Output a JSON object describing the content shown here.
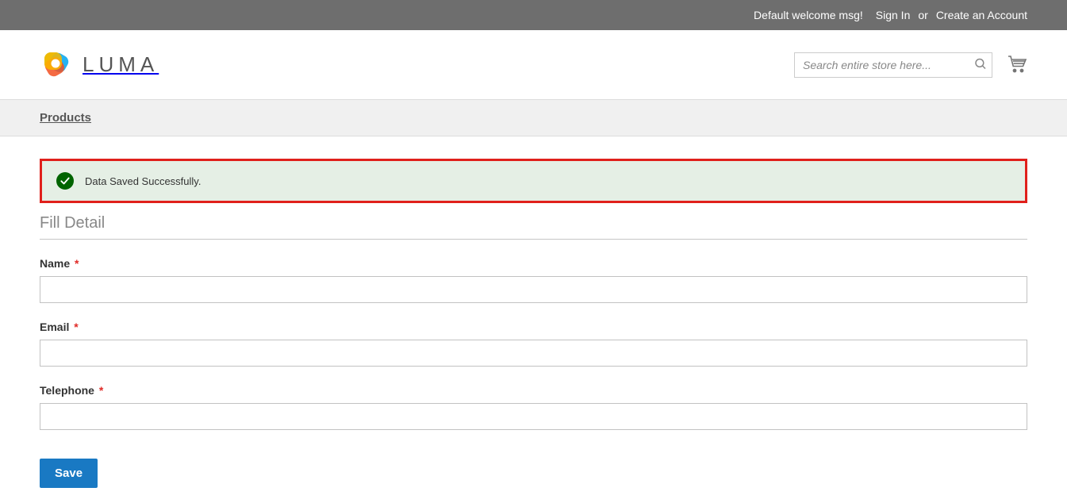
{
  "panel": {
    "welcome": "Default welcome msg!",
    "sign_in": "Sign In",
    "or": "or",
    "create_account": "Create an Account"
  },
  "header": {
    "logo_text": "LUMA",
    "search_placeholder": "Search entire store here..."
  },
  "nav": {
    "item": "Products"
  },
  "message": {
    "success": "Data Saved Successfully."
  },
  "form": {
    "legend": "Fill Detail",
    "fields": {
      "name": {
        "label": "Name",
        "value": ""
      },
      "email": {
        "label": "Email",
        "value": ""
      },
      "telephone": {
        "label": "Telephone",
        "value": ""
      }
    },
    "required_mark": "*",
    "save_label": "Save"
  }
}
